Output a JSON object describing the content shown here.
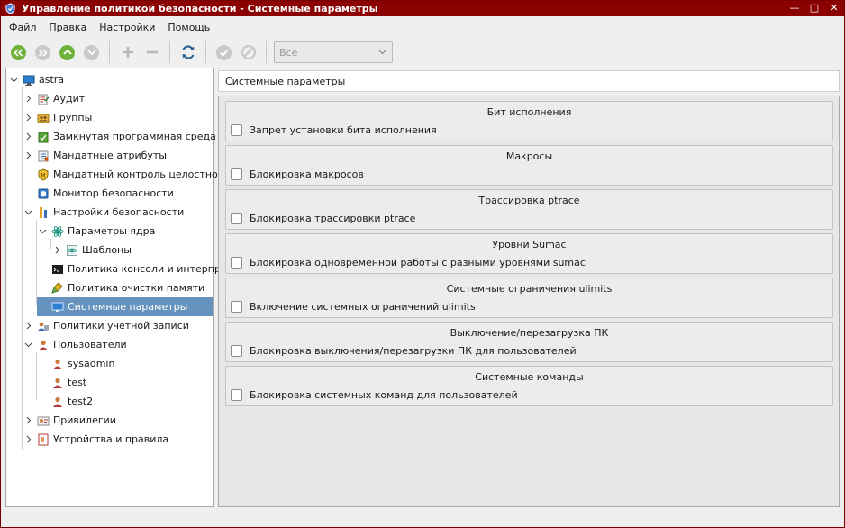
{
  "window": {
    "title": "Управление политикой безопасности - Системные параметры"
  },
  "menu": [
    "Файл",
    "Правка",
    "Настройки",
    "Помощь"
  ],
  "toolbar": {
    "filter_value": "Все",
    "buttons": [
      "back-double-icon",
      "forward-double-icon",
      "up-icon",
      "down-icon",
      "add-icon",
      "remove-icon",
      "refresh-icon",
      "apply-icon",
      "cancel-icon"
    ]
  },
  "tree": [
    {
      "label": "astra",
      "icon": "computer-icon"
    },
    {
      "label": "Аудит",
      "icon": "audit-icon"
    },
    {
      "label": "Группы",
      "icon": "groups-icon"
    },
    {
      "label": "Замкнутая программная среда",
      "icon": "closed-env-icon"
    },
    {
      "label": "Мандатные атрибуты",
      "icon": "mandatory-attributes-icon"
    },
    {
      "label": "Мандатный контроль целостности",
      "icon": "integrity-control-icon"
    },
    {
      "label": "Монитор безопасности",
      "icon": "security-monitor-icon"
    },
    {
      "label": "Настройки безопасности",
      "icon": "security-settings-icon"
    },
    {
      "label": "Параметры ядра",
      "icon": "kernel-params-icon"
    },
    {
      "label": "Шаблоны",
      "icon": "templates-icon"
    },
    {
      "label": "Политика консоли и интерпр...",
      "icon": "console-icon"
    },
    {
      "label": "Политика очистки памяти",
      "icon": "memory-cleanup-icon"
    },
    {
      "label": "Системные параметры",
      "icon": "system-params-icon"
    },
    {
      "label": "Политики учетной записи",
      "icon": "account-policy-icon"
    },
    {
      "label": "Пользователи",
      "icon": "users-icon"
    },
    {
      "label": "sysadmin",
      "icon": "user-icon"
    },
    {
      "label": "test",
      "icon": "user-icon"
    },
    {
      "label": "test2",
      "icon": "user-icon"
    },
    {
      "label": "Привилегии",
      "icon": "privileges-icon"
    },
    {
      "label": "Устройства и правила",
      "icon": "devices-rules-icon"
    }
  ],
  "content": {
    "header": "Системные параметры",
    "groups": [
      {
        "title": "Бит исполнения",
        "option": "Запрет установки бита исполнения",
        "checked": false
      },
      {
        "title": "Макросы",
        "option": "Блокировка макросов",
        "checked": false
      },
      {
        "title": "Трассировка ptrace",
        "option": "Блокировка трассировки ptrace",
        "checked": false
      },
      {
        "title": "Уровни Sumac",
        "option": "Блокировка одновременной работы с разными уровнями sumac",
        "checked": false
      },
      {
        "title": "Системные ограничения ulimits",
        "option": "Включение системных ограничений ulimits",
        "checked": false
      },
      {
        "title": "Выключение/перезагрузка ПК",
        "option": "Блокировка выключения/перезагрузки ПК для пользователей",
        "checked": false
      },
      {
        "title": "Системные команды",
        "option": "Блокировка системных команд для пользователей",
        "checked": false
      }
    ]
  }
}
